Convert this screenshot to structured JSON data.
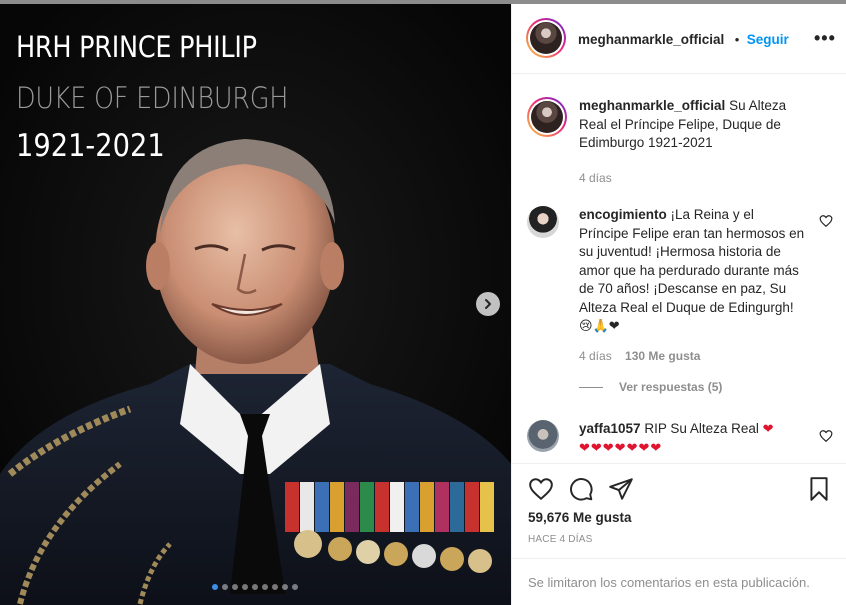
{
  "post": {
    "overlay_title": "HRH PRINCE PHILIP",
    "overlay_subtitle": "DUKE OF EDINBURGH",
    "overlay_years": "1921-2021",
    "carousel": {
      "total_slides": 9,
      "active_index": 0
    }
  },
  "header": {
    "username": "meghanmarkle_official",
    "separator": "•",
    "follow_label": "Seguir",
    "more_label": "•••"
  },
  "caption": {
    "username": "meghanmarkle_official",
    "text": "Su Alteza Real el Príncipe Felipe, Duque de Edimburgo 1921-2021",
    "age": "4 días"
  },
  "comments": [
    {
      "username": "encogimiento",
      "text": "¡La Reina y el Príncipe Felipe eran tan hermosos en su juventud! ¡Hermosa historia de amor que ha perdurado durante más de 70 años! ¡Descanse en paz, Su Alteza Real el Duque de Edingurgh!",
      "emojis": "😢🙏❤",
      "age": "4 días",
      "likes": "130 Me gusta",
      "replies_label": "Ver respuestas (5)"
    },
    {
      "username": "yaffa1057",
      "text": "RIP Su Alteza Real",
      "emoji_line1": "❤",
      "emoji_line2": "❤❤❤❤❤❤❤"
    }
  ],
  "actions": {
    "likes": "59,676 Me gusta",
    "time": "HACE 4 DÍAS"
  },
  "footer": {
    "comments_limited": "Se limitaron los comentarios en esta publicación."
  },
  "colors": {
    "accent": "#0095f6",
    "heart": "#e0142f",
    "text": "#262626",
    "muted": "#8e8e8e"
  }
}
